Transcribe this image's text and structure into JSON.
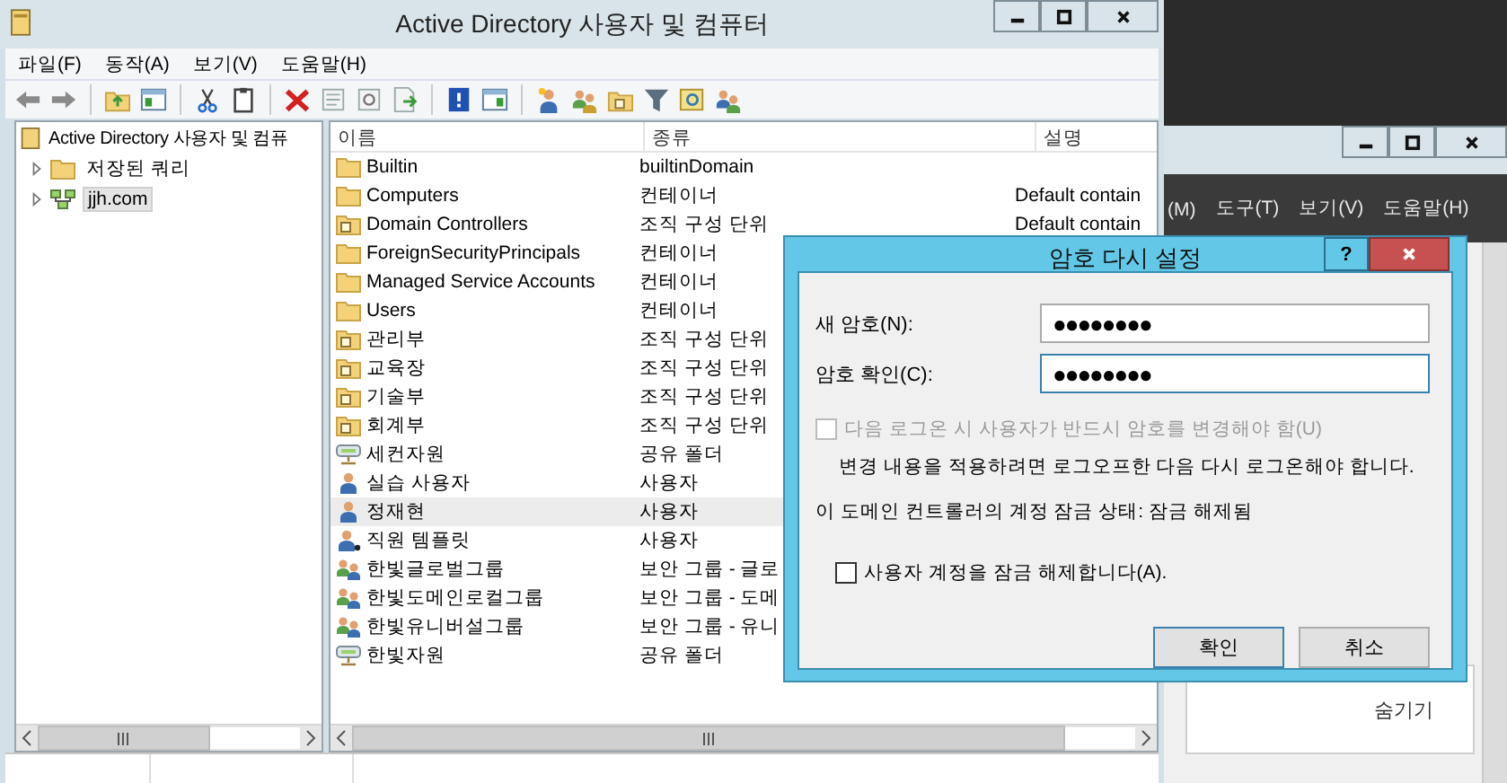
{
  "main_window": {
    "title": "Active Directory 사용자 및 컴퓨터",
    "menu": [
      "파일(F)",
      "동작(A)",
      "보기(V)",
      "도움말(H)"
    ],
    "tree": {
      "label": "Active Directory 사용자 및 컴퓨",
      "children": [
        {
          "label": "저장된 쿼리",
          "kind": "folder",
          "expanded": false,
          "selected": false
        },
        {
          "label": "jjh.com",
          "kind": "domain",
          "expanded": false,
          "selected": true
        }
      ]
    },
    "table": {
      "columns": [
        "이름",
        "종류",
        "설명"
      ],
      "rows": [
        {
          "kind": "folder",
          "name": "Builtin",
          "type": "builtinDomain",
          "selected": false
        },
        {
          "kind": "folder",
          "name": "Computers",
          "type": "컨테이너",
          "description": "Default contain",
          "selected": false
        },
        {
          "kind": "ou",
          "name": "Domain Controllers",
          "type": "조직 구성 단위",
          "description": "Default contain",
          "selected": false
        },
        {
          "kind": "folder",
          "name": "ForeignSecurityPrincipals",
          "type": "컨테이너",
          "selected": false
        },
        {
          "kind": "folder",
          "name": "Managed Service Accounts",
          "type": "컨테이너",
          "selected": false
        },
        {
          "kind": "folder",
          "name": "Users",
          "type": "컨테이너",
          "selected": false
        },
        {
          "kind": "ou",
          "name": "관리부",
          "type": "조직 구성 단위",
          "selected": false
        },
        {
          "kind": "ou",
          "name": "교육장",
          "type": "조직 구성 단위",
          "selected": false
        },
        {
          "kind": "ou",
          "name": "기술부",
          "type": "조직 구성 단위",
          "selected": false
        },
        {
          "kind": "ou",
          "name": "회계부",
          "type": "조직 구성 단위",
          "selected": false
        },
        {
          "kind": "share",
          "name": "세컨자원",
          "type": "공유 폴더",
          "selected": false
        },
        {
          "kind": "user",
          "name": "실습 사용자",
          "type": "사용자",
          "selected": false
        },
        {
          "kind": "user",
          "name": "정재현",
          "type": "사용자",
          "selected": true
        },
        {
          "kind": "template",
          "name": "직원 템플릿",
          "type": "사용자",
          "selected": false
        },
        {
          "kind": "group",
          "name": "한빛글로벌그룹",
          "type": "보안 그룹 - 글로",
          "selected": false
        },
        {
          "kind": "group",
          "name": "한빛도메인로컬그룹",
          "type": "보안 그룹 - 도메",
          "selected": false
        },
        {
          "kind": "group",
          "name": "한빛유니버설그룹",
          "type": "보안 그룹 - 유니",
          "selected": false
        },
        {
          "kind": "share",
          "name": "한빛자원",
          "type": "공유 폴더",
          "selected": false
        }
      ]
    }
  },
  "back_window": {
    "menu": [
      "(M)",
      "도구(T)",
      "보기(V)",
      "도움말(H)"
    ],
    "hide_link": "숨기기"
  },
  "dialog": {
    "title": "암호 다시 설정",
    "help_button": "?",
    "fields": [
      {
        "label": "새 암호(N):",
        "value": "●●●●●●●●",
        "focused": false
      },
      {
        "label": "암호 확인(C):",
        "value": "●●●●●●●●",
        "focused": true
      }
    ],
    "must_change": {
      "label": "다음 로그온 시 사용자가 반드시 암호를 변경해야 함(U)",
      "checked": false,
      "disabled": true
    },
    "note": "변경 내용을 적용하려면 로그오프한 다음 다시 로그온해야 합니다.",
    "lock_status": "이 도메인 컨트롤러의 계정 잠금 상태: 잠금 해제됨",
    "unlock": {
      "label": "사용자 계정을 잠금 해제합니다(A).",
      "checked": false,
      "disabled": false
    },
    "buttons": [
      {
        "label": "확인",
        "default": true
      },
      {
        "label": "취소",
        "default": false
      }
    ]
  }
}
